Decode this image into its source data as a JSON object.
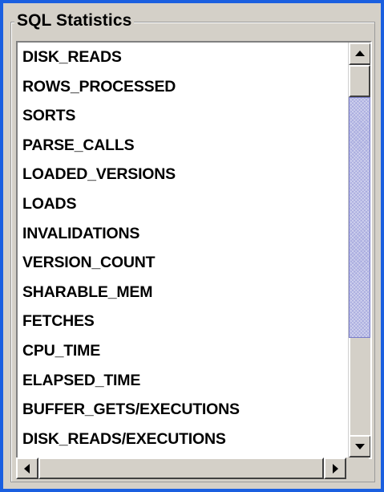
{
  "group": {
    "title": "SQL Statistics"
  },
  "list": {
    "items": [
      "DISK_READS",
      "ROWS_PROCESSED",
      "SORTS",
      "PARSE_CALLS",
      "LOADED_VERSIONS",
      "LOADS",
      "INVALIDATIONS",
      "VERSION_COUNT",
      "SHARABLE_MEM",
      "FETCHES",
      "CPU_TIME",
      "ELAPSED_TIME",
      "BUFFER_GETS/EXECUTIONS",
      "DISK_READS/EXECUTIONS"
    ]
  },
  "icons": {
    "scroll_up": "arrow-up-icon",
    "scroll_down": "arrow-down-icon",
    "scroll_left": "arrow-left-icon",
    "scroll_right": "arrow-right-icon"
  },
  "colors": {
    "window_border": "#1a5fe0",
    "panel": "#d4d0c8",
    "thumb": "#a9acdf"
  }
}
